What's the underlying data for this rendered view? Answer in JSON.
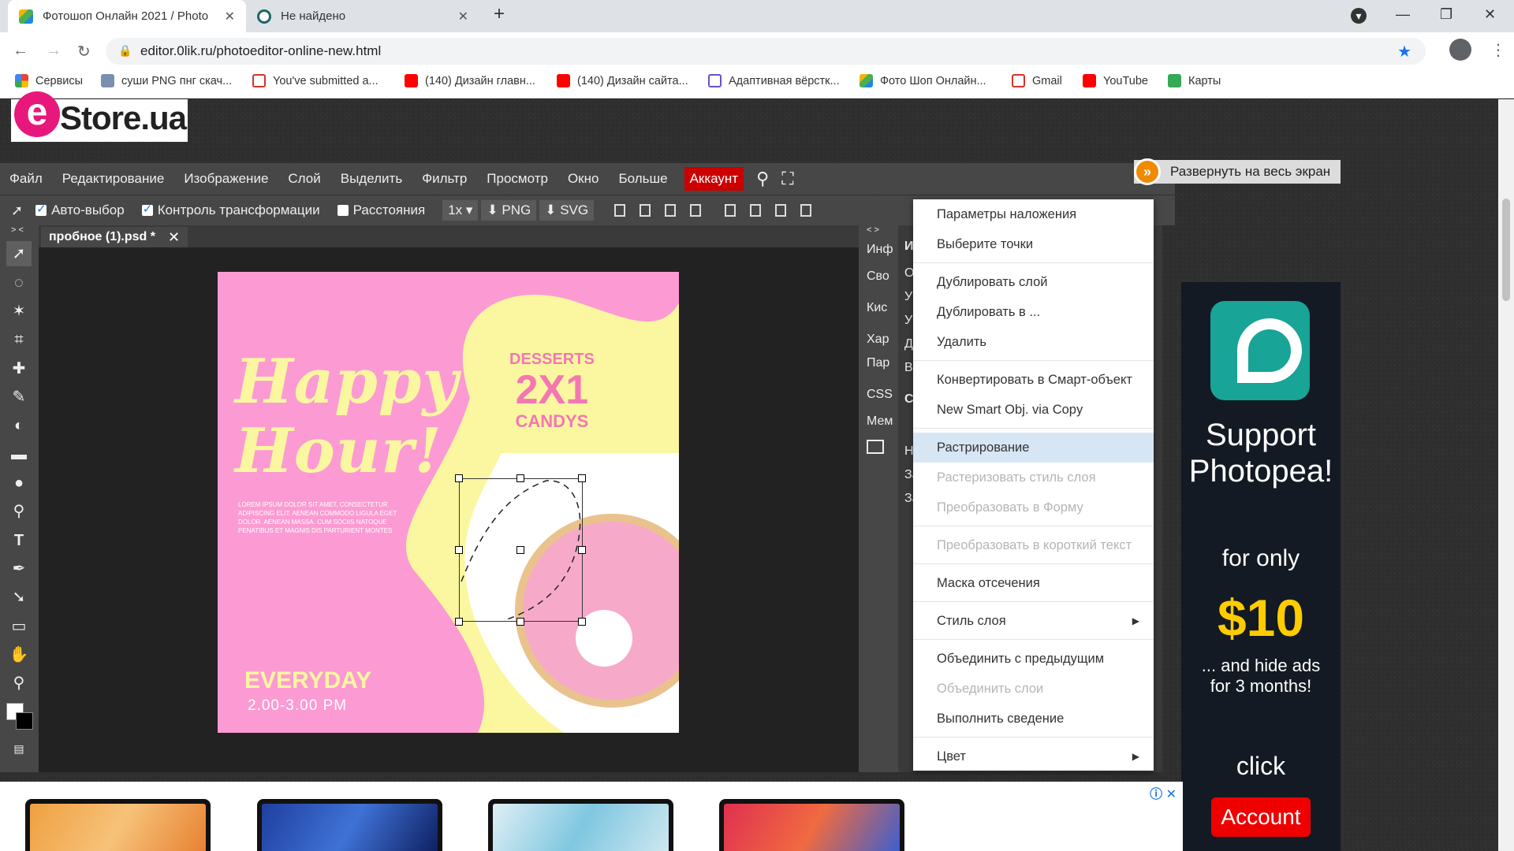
{
  "browser": {
    "tabs": [
      {
        "title": "Фотошоп Онлайн 2021 / Photo",
        "active": true
      },
      {
        "title": "Не найдено",
        "active": false
      }
    ],
    "new_tab": "+",
    "url": "editor.0lik.ru/photoeditor-online-new.html",
    "bookmarks": [
      {
        "label": "Сервисы",
        "icon": "apps-icon",
        "color": "#ea4335"
      },
      {
        "label": "суши PNG пнг скач...",
        "icon": "png-site-icon",
        "color": "#7b8fb0"
      },
      {
        "label": "You've submitted a...",
        "icon": "gmail-icon",
        "color": "#d93025"
      },
      {
        "label": "(140) Дизайн главн...",
        "icon": "youtube-icon",
        "color": "#ff0000"
      },
      {
        "label": "(140) Дизайн сайта...",
        "icon": "youtube-icon",
        "color": "#ff0000"
      },
      {
        "label": "Адаптивная вёрстк...",
        "icon": "htmlacademy-icon",
        "color": "#6a4fcf"
      },
      {
        "label": "Фото Шоп Онлайн...",
        "icon": "photoshop-online-icon",
        "color": "#4caf50"
      },
      {
        "label": "Gmail",
        "icon": "gmail-icon",
        "color": "#d93025"
      },
      {
        "label": "YouTube",
        "icon": "youtube-icon",
        "color": "#ff0000"
      },
      {
        "label": "Карты",
        "icon": "maps-icon",
        "color": "#34a853"
      }
    ]
  },
  "site": {
    "logo_e": "e",
    "logo_text": "Store.ua"
  },
  "editor": {
    "menu": [
      "Файл",
      "Редактирование",
      "Изображение",
      "Слой",
      "Выделить",
      "Фильтр",
      "Просмотр",
      "Окно",
      "Больше"
    ],
    "account": "Аккаунт",
    "expand": "Развернуть на весь экран",
    "options": {
      "auto_select": "Авто-выбор",
      "transform_controls": "Контроль трансформации",
      "distances": "Расстояния",
      "zoom": "1x",
      "png": "PNG",
      "svg": "SVG"
    },
    "doc_tab": "пробное (1).psd *",
    "panel_toggle_left": "> <",
    "panel_toggle_right": "< >",
    "panel_tabs": [
      "Инф",
      "Сво",
      "Кис",
      "Хар",
      "Пар",
      "CSS",
      "Мем"
    ],
    "right_panel_letters": [
      "И",
      "О",
      "У",
      "У",
      "Д",
      "В",
      "С",
      "Н",
      "За",
      "За"
    ]
  },
  "artwork": {
    "happy": "Happy",
    "hour": "Hour!",
    "desserts": "DESSERTS",
    "promo": "2X1",
    "candys": "CANDYS",
    "lorem": "LOREM IPSUM DOLOR SIT AMET, CONSECTETUR ADIPISCING ELIT. AENEAN COMMODO LIGULA EGET DOLOR. AENEAN MASSA. CUM SOCIIS NATOQUE PENATIBUS ET MAGNIS DIS PARTURIENT MONTES",
    "everyday": "EVERYDAY",
    "time": "2.00-3.00 PM"
  },
  "context_menu": [
    {
      "label": "Параметры наложения",
      "state": "normal"
    },
    {
      "label": "Выберите точки",
      "state": "normal"
    },
    {
      "label": "Дублировать слой",
      "state": "normal"
    },
    {
      "label": "Дублировать в ...",
      "state": "normal"
    },
    {
      "label": "Удалить",
      "state": "normal"
    },
    {
      "label": "Конвертировать в Смарт-объект",
      "state": "normal"
    },
    {
      "label": "New Smart Obj. via Copy",
      "state": "normal"
    },
    {
      "label": "Растрирование",
      "state": "highlighted"
    },
    {
      "label": "Растеризовать стиль слоя",
      "state": "disabled"
    },
    {
      "label": "Преобразовать в Форму",
      "state": "disabled"
    },
    {
      "label": "Преобразовать в короткий текст",
      "state": "disabled"
    },
    {
      "label": "Маска отсечения",
      "state": "normal"
    },
    {
      "label": "Стиль слоя",
      "state": "submenu"
    },
    {
      "label": "Объединить с предыдущим",
      "state": "normal"
    },
    {
      "label": "Объединить слои",
      "state": "disabled"
    },
    {
      "label": "Выполнить сведение",
      "state": "normal"
    },
    {
      "label": "Цвет",
      "state": "submenu"
    }
  ],
  "ad": {
    "line1": "Support",
    "line2": "Photopea!",
    "for_only": "for only",
    "price": "$10",
    "hide1": "... and hide ads",
    "hide2": "for 3 months!",
    "click": "click",
    "button": "Account"
  }
}
